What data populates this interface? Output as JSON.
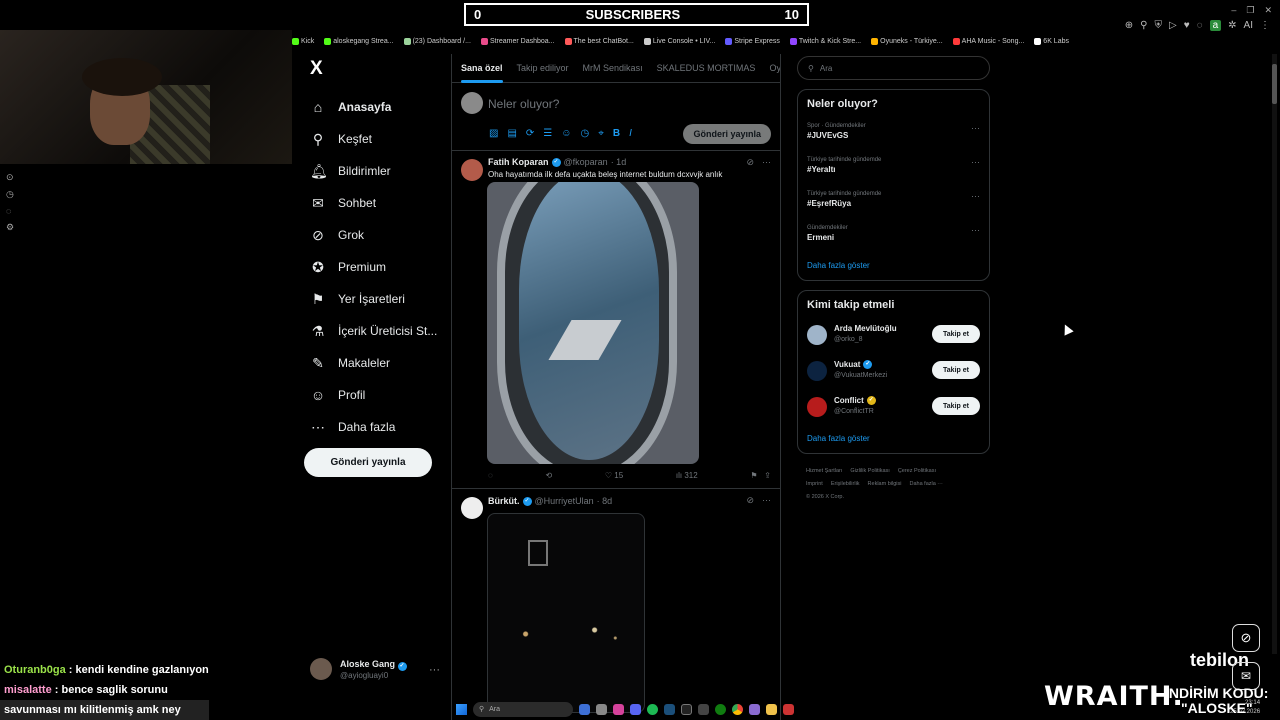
{
  "overlay": {
    "subs_left": "0",
    "subs_title": "SUBSCRIBERS",
    "subs_right": "10"
  },
  "browser": {
    "bookmarks": [
      {
        "label": "Kick",
        "color": "#53fc18"
      },
      {
        "label": "aloskegang Strea...",
        "color": "#53fc18"
      },
      {
        "label": "(23) Dashboard /...",
        "color": "#9bd39b"
      },
      {
        "label": "Streamer Dashboa...",
        "color": "#e94b8a"
      },
      {
        "label": "The best ChatBot...",
        "color": "#ff5a5a"
      },
      {
        "label": "Live Console • LIV...",
        "color": "#cccccc"
      },
      {
        "label": "Stripe Express",
        "color": "#635bff"
      },
      {
        "label": "Twitch & Kick Stre...",
        "color": "#9146ff"
      },
      {
        "label": "Oyuneks - Türkiye...",
        "color": "#ffb400"
      },
      {
        "label": "AHA Music - Song...",
        "color": "#ff3a3a"
      },
      {
        "label": "6K Labs",
        "color": "#ffffff"
      }
    ],
    "extension_label": "AI"
  },
  "nav": {
    "logo": "X",
    "items": [
      {
        "label": "Anasayfa",
        "icon": "⌂",
        "name": "home"
      },
      {
        "label": "Keşfet",
        "icon": "⚲",
        "name": "explore"
      },
      {
        "label": "Bildirimler",
        "icon": "🔔︎",
        "name": "notifications"
      },
      {
        "label": "Sohbet",
        "icon": "✉",
        "name": "chat"
      },
      {
        "label": "Grok",
        "icon": "⊘",
        "name": "grok"
      },
      {
        "label": "Premium",
        "icon": "✪",
        "name": "premium"
      },
      {
        "label": "Yer İşaretleri",
        "icon": "⚑",
        "name": "bookmarks"
      },
      {
        "label": "İçerik Üreticisi St...",
        "icon": "⚗",
        "name": "creator-studio"
      },
      {
        "label": "Makaleler",
        "icon": "✎",
        "name": "articles"
      },
      {
        "label": "Profil",
        "icon": "☺",
        "name": "profile"
      },
      {
        "label": "Daha fazla",
        "icon": "⋯",
        "name": "more"
      }
    ],
    "post_button": "Gönderi yayınla",
    "account": {
      "name": "Aloske Gang",
      "handle": "@ayiogluayi0"
    }
  },
  "feed": {
    "tabs": [
      "Sana özel",
      "Takip ediliyor",
      "MrM Sendikası",
      "SKALEDUS MORTIMAS",
      "Oyu"
    ],
    "compose_placeholder": "Neler oluyor?",
    "compose_button": "Gönderi yayınla",
    "compose_tools": [
      "▨",
      "▤",
      "⟳",
      "☰",
      "☺",
      "◷",
      "⌖",
      "B",
      "I"
    ],
    "tweets": [
      {
        "name": "Fatih Koparan",
        "handle": "@fkoparan",
        "time": "· 1d",
        "text": "Oha hayatımda ilk defa uçakta beleş internet buldum dcxvvjk anlık",
        "likes": "15",
        "views": "312"
      },
      {
        "name": "Bürküt.",
        "handle": "@HurriyetUlan",
        "time": "· 8d",
        "text": ""
      }
    ]
  },
  "sidebar": {
    "search_placeholder": "Ara",
    "trends_title": "Neler oluyor?",
    "trends": [
      {
        "context": "Spor · Gündemdekiler",
        "topic": "#JUVEvGS"
      },
      {
        "context": "Türkiye tarihinde gündemde",
        "topic": "#Yeraltı"
      },
      {
        "context": "Türkiye tarihinde gündemde",
        "topic": "#EşrefRüya"
      },
      {
        "context": "Gündemdekiler",
        "topic": "Ermeni"
      }
    ],
    "trends_more": "Daha fazla göster",
    "follow_title": "Kimi takip etmeli",
    "suggestions": [
      {
        "name": "Arda Mevlütoğlu",
        "handle": "@orko_8",
        "button": "Takip et",
        "verified": "none"
      },
      {
        "name": "Vukuat",
        "handle": "@VukuatMerkezi",
        "button": "Takip et",
        "verified": "blue"
      },
      {
        "name": "Conflict",
        "handle": "@ConflictTR",
        "button": "Takip et",
        "verified": "gold"
      }
    ],
    "follow_more": "Daha fazla göster",
    "footer": [
      "Hizmet Şartları",
      "Gizlilik Politikası",
      "Çerez Politikası",
      "Imprint",
      "Erişilebilirlik",
      "Reklam bilgisi",
      "Daha fazla ···",
      "© 2026 X Corp."
    ]
  },
  "chat": [
    {
      "user": "Oturanb0ga",
      "message": " : kendi kendine gazlanıyon"
    },
    {
      "user": "misalatte",
      "message": " : bence saglik sorunu"
    },
    {
      "user": "",
      "message": "savunması mı kilitlenmiş amk ney"
    }
  ],
  "stream": {
    "sponsor": "WRAITH.",
    "promo_line1": "İNDİRİM KODU:",
    "promo_line2": "\"ALOSKE\"",
    "brand": "tebilon"
  },
  "taskbar": {
    "search": "Ara",
    "time": "23:14",
    "date": "25.02.2026"
  }
}
